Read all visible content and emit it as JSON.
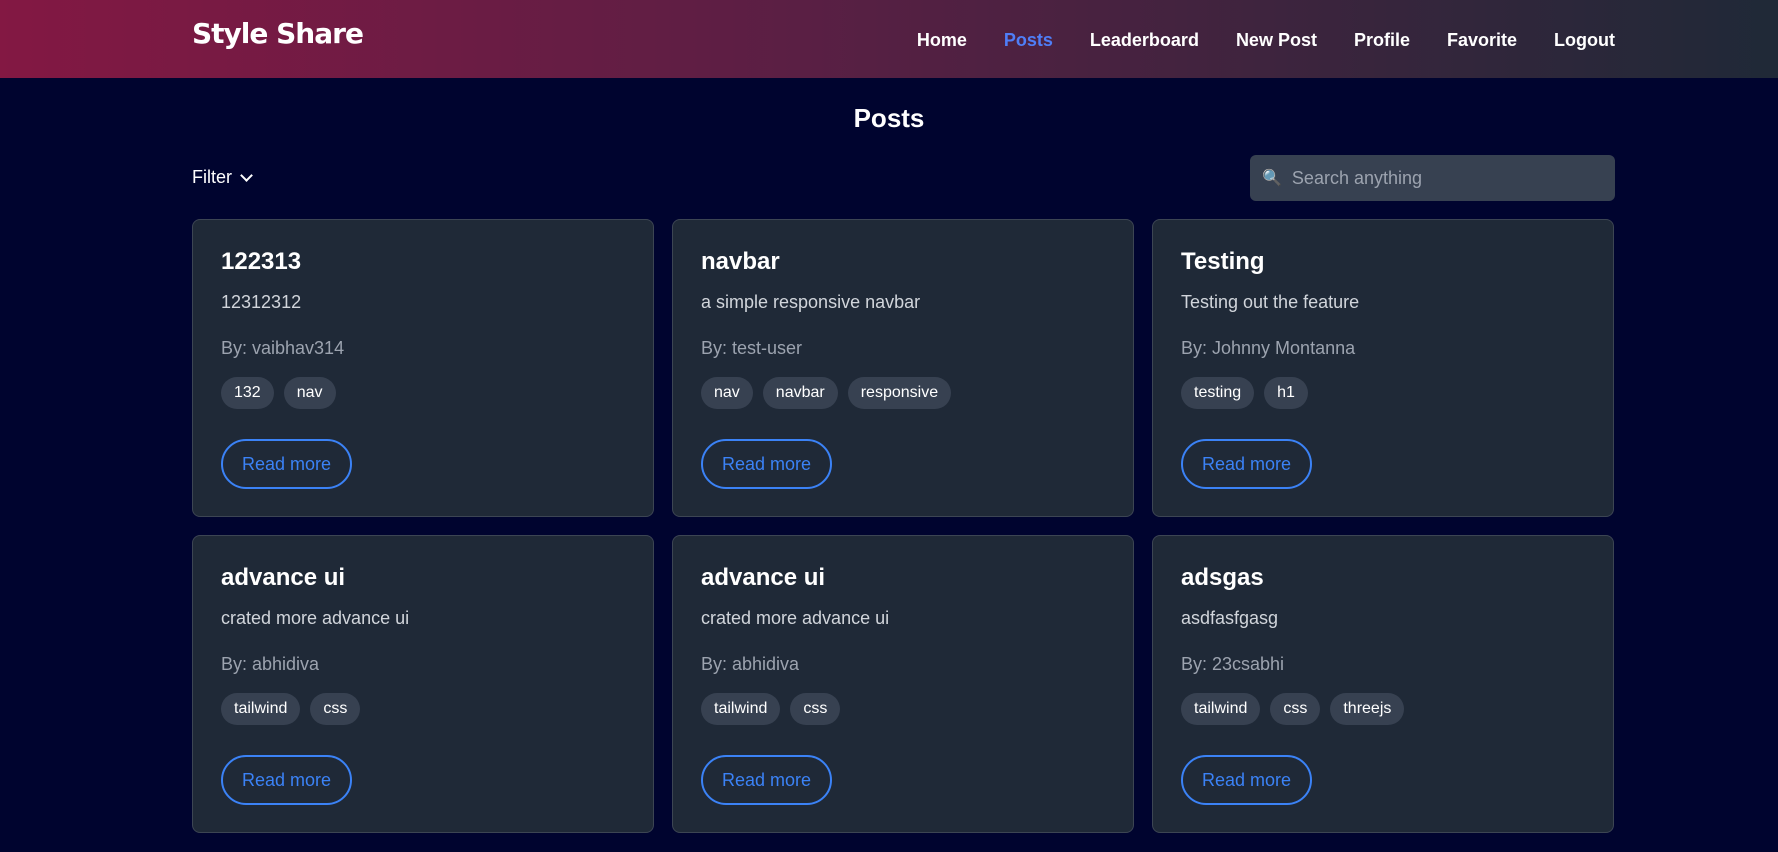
{
  "navbar": {
    "brand": "Style Share",
    "links": [
      {
        "label": "Home",
        "active": false
      },
      {
        "label": "Posts",
        "active": true
      },
      {
        "label": "Leaderboard",
        "active": false
      },
      {
        "label": "New Post",
        "active": false
      },
      {
        "label": "Profile",
        "active": false
      },
      {
        "label": "Favorite",
        "active": false
      },
      {
        "label": "Logout",
        "active": false
      }
    ]
  },
  "page": {
    "title": "Posts"
  },
  "filter": {
    "label": "Filter",
    "icon": "chevron-down-icon"
  },
  "search": {
    "placeholder": "Search anything",
    "value": "",
    "icon": "search-icon"
  },
  "posts": [
    {
      "title": "122313",
      "description": "12312312",
      "author": "By: vaibhav314",
      "tags": [
        "132",
        "nav"
      ],
      "cta": "Read more"
    },
    {
      "title": "navbar",
      "description": "a simple responsive navbar",
      "author": "By: test-user",
      "tags": [
        "nav",
        "navbar",
        "responsive"
      ],
      "cta": "Read more"
    },
    {
      "title": "Testing",
      "description": "Testing out the feature",
      "author": "By: Johnny Montanna",
      "tags": [
        "testing",
        "h1"
      ],
      "cta": "Read more"
    },
    {
      "title": "advance ui",
      "description": "crated more advance ui",
      "author": "By: abhidiva",
      "tags": [
        "tailwind",
        "css"
      ],
      "cta": "Read more"
    },
    {
      "title": "advance ui",
      "description": "crated more advance ui",
      "author": "By: abhidiva",
      "tags": [
        "tailwind",
        "css"
      ],
      "cta": "Read more"
    },
    {
      "title": "adsgas",
      "description": "asdfasfgasg",
      "author": "By: 23csabhi",
      "tags": [
        "tailwind",
        "css",
        "threejs"
      ],
      "cta": "Read more"
    }
  ],
  "colors": {
    "background": "#00042f",
    "navbar_gradient_start": "#831843",
    "navbar_gradient_end": "#1f2937",
    "accent": "#3b82f6",
    "card": "#1f2937",
    "tag": "#374151"
  }
}
